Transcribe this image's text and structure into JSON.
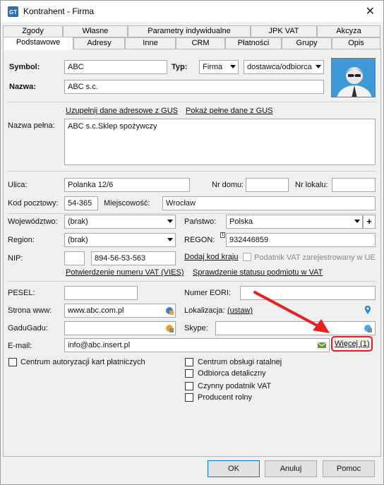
{
  "window": {
    "title": "Kontrahent - Firma",
    "close": "✕"
  },
  "tabs_row1": [
    "Zgody",
    "Własne",
    "Parametry indywidualne",
    "JPK VAT",
    "Akcyza"
  ],
  "tabs_row2": [
    "Podstawowe",
    "Adresy",
    "Inne",
    "CRM",
    "Płatności",
    "Grupy",
    "Opis"
  ],
  "active_tab": "Podstawowe",
  "form": {
    "symbol_label": "Symbol:",
    "symbol": "ABC",
    "typ_label": "Typ:",
    "typ": "Firma",
    "typ2": "dostawca/odbiorca",
    "nazwa_label": "Nazwa:",
    "nazwa": "ABC s.c.",
    "gus_link": "Uzupełnij dane adresowe z GUS",
    "gus_full_link": "Pokaż pełne dane z GUS",
    "nazwa_pelna_label": "Nazwa pełna:",
    "nazwa_pelna": "ABC s.c.Sklep spożywczy",
    "ulica_label": "Ulica:",
    "ulica": "Polanka  12/6",
    "nr_domu_label": "Nr domu:",
    "nr_domu": "",
    "nr_lokalu_label": "Nr lokalu:",
    "nr_lokalu": "",
    "kod_label": "Kod pocztowy:",
    "kod": "54-365",
    "miejscowosc_label": "Miejscowość:",
    "miejscowosc": "Wrocław",
    "wojewodztwo_label": "Województwo:",
    "wojewodztwo": "(brak)",
    "panstwo_label": "Państwo:",
    "panstwo": "Polska",
    "region_label": "Region:",
    "region": "(brak)",
    "regon_label": "REGON:",
    "regon": "932446859",
    "nip_label": "NIP:",
    "nip_prefix": "",
    "nip": "894-56-53-563",
    "kod_kraju_link": "Dodaj kod kraju",
    "vat_ue_label": "Podatnik VAT zarejestrowany w UE",
    "vies_link": "Potwierdzenie numeru VAT (VIES)",
    "status_link": "Sprawdzenie statusu podmiotu w VAT",
    "pesel_label": "PESEL:",
    "pesel": "",
    "eori_label": "Numer EORI:",
    "eori": "",
    "www_label": "Strona www:",
    "www": "www.abc.com.pl",
    "lokalizacja_label": "Lokalizacja:",
    "ustaw_link": "(ustaw)",
    "gadu_label": "GaduGadu:",
    "gadu": "",
    "skype_label": "Skype:",
    "skype": "",
    "email_label": "E-mail:",
    "email": "info@abc.insert.pl",
    "wiecej_link": "Więcej (1)"
  },
  "checks": {
    "car": "Centrum autoryzacji kart płatniczych",
    "cor": "Centrum obsługi ratalnej",
    "odbiorca": "Odbiorca detaliczny",
    "czynny": "Czynny podatnik VAT",
    "producent": "Producent rolny"
  },
  "buttons": {
    "ok": "OK",
    "anuluj": "Anuluj",
    "pomoc": "Pomoc"
  },
  "colors": {
    "highlight": "#e02020",
    "arrow": "#e8201e",
    "link_box": "#e02020"
  }
}
